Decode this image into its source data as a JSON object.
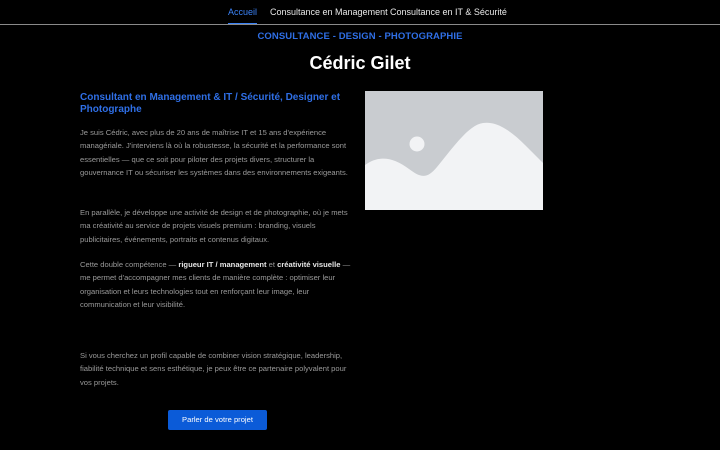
{
  "nav": {
    "items": [
      {
        "label": "Accueil",
        "active": true
      },
      {
        "label": "Consultance en Management",
        "active": false
      },
      {
        "label": "Consultance en IT & Sécurité",
        "active": false
      }
    ]
  },
  "header": {
    "tagline": "CONSULTANCE - DESIGN - PHOTOGRAPHIE",
    "name": "Cédric Gilet"
  },
  "main": {
    "subtitle": "Consultant en Management & IT / Sécurité, Designer et Photographe",
    "para1": "Je suis Cédric, avec plus de 20 ans de maîtrise IT et 15 ans d'expérience managériale. J'interviens là où la robustesse, la sécurité et la performance sont essentielles — que ce soit pour piloter des projets divers, structurer la gouvernance IT ou sécuriser les systèmes dans des environnements exigeants.",
    "para2": "En parallèle, je développe une activité de design et de photographie, où je mets ma créativité au service de projets visuels premium : branding, visuels publicitaires, événements, portraits et contenus digitaux.",
    "para3": {
      "part1": "Cette double compétence — ",
      "bold1": "rigueur IT / management",
      "part2": " et ",
      "bold2": "créativité visuelle",
      "part3": " — me permet d'accompagner mes clients de manière complète : optimiser leur organisation et leurs technologies tout en renforçant leur image, leur communication et leur visibilité."
    },
    "para4": "Si vous cherchez un profil capable de combiner vision stratégique, leadership, fiabilité technique et sens esthétique, je peux être ce partenaire polyvalent pour vos projets.",
    "cta_label": "Parler de votre projet"
  },
  "colors": {
    "accent": "#2f6fe6",
    "button": "#0b5bd8",
    "background": "#000000",
    "placeholder": "#c9ccd0"
  },
  "image": {
    "icon": "image-placeholder-icon"
  }
}
